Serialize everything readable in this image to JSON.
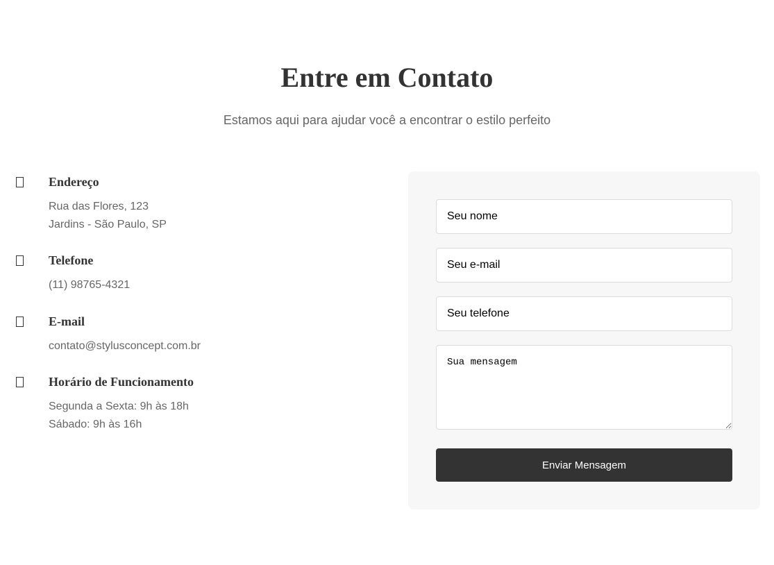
{
  "header": {
    "title": "Entre em Contato",
    "subtitle": "Estamos aqui para ajudar você a encontrar o estilo perfeito"
  },
  "contact_info": {
    "items": [
      {
        "icon": "map-marker-icon",
        "heading": "Endereço",
        "lines": [
          "Rua das Flores, 123",
          "Jardins - São Paulo, SP"
        ]
      },
      {
        "icon": "phone-icon",
        "heading": "Telefone",
        "lines": [
          "(11) 98765-4321"
        ]
      },
      {
        "icon": "envelope-icon",
        "heading": "E-mail",
        "lines": [
          "contato@stylusconcept.com.br"
        ]
      },
      {
        "icon": "clock-icon",
        "heading": "Horário de Funcionamento",
        "lines": [
          "Segunda a Sexta: 9h às 18h",
          "Sábado: 9h às 16h"
        ]
      }
    ]
  },
  "form": {
    "name_placeholder": "Seu nome",
    "email_placeholder": "Seu e-mail",
    "phone_placeholder": "Seu telefone",
    "message_placeholder": "Sua mensagem",
    "submit_label": "Enviar Mensagem"
  },
  "colors": {
    "text_dark": "#333333",
    "text_muted": "#666666",
    "panel_background": "#f7f7f7",
    "button_background": "#333333",
    "button_text": "#ffffff",
    "input_border": "#dddddd"
  }
}
